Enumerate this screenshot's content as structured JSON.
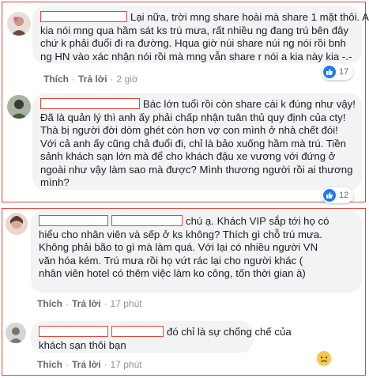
{
  "comments": [
    {
      "lines": [
        "Lại nữa, trời mng share hoài mà share 1 mặt thôi. A",
        "kia nói mng qua hầm sát ks trú mưa, rất nhiều ng đang trú bên đây",
        "chứ k phải đuổi đi ra đường. Hqua giờ núi share núi ng nói rồi bnh",
        "ng HN vào xác nhận nói rồi mà mng vẫn share r nói a kia này kia -.-"
      ],
      "actions": {
        "like": "Thích",
        "reply": "Trả lời",
        "time": "2 giờ"
      },
      "reactions": {
        "type": "like",
        "count": "17"
      }
    },
    {
      "lines": [
        "Bác lớn tuổi rồi còn share cái k đúng như vậy!",
        "Đã là quản lý thì anh ấy phải chấp nhận tuân thủ quy định của cty!",
        "Thà bị người đời dòm ghét còn hơn vợ con mình ở nhà chết đói!",
        "Với cả anh ấy cũng chả đuổi đi, chỉ là bảo xuống hầm mà trú. Tiền",
        "sảnh khách sạn lớn mà để cho khách đậu xe vương với đứng ở",
        "ngoài như vậy làm sao mà được? Mình thương người rồi ai thương",
        "mình?"
      ],
      "actions": {
        "like": "Thích",
        "reply": "Trả lời",
        "time": ""
      },
      "reactions": {
        "type": "like",
        "count": "12"
      }
    },
    {
      "lines": [
        "chú ạ. Khách VIP sắp tới họ có",
        "hiểu cho nhân viên và sếp ở ks không? Thích gì chỗ trú mưa.",
        "Không phải bão to gì mà làm quá. Với lại có nhiều người VN",
        "văn hóa kém. Trú mưa rồi họ vứt rác lại cho người khác (",
        "nhân viên hotel có thêm việc làm ko công, tốn thời gian à)"
      ],
      "actions": {
        "like": "Thích",
        "reply": "Trả lời",
        "time": "17 phút"
      }
    },
    {
      "lines": [
        "đó chỉ là sự chống chế của",
        "khách sạn thôi bạn"
      ],
      "actions": {
        "like": "Thích",
        "reply": "Trả lời",
        "time": "17 phút"
      },
      "reactions": {
        "type": "sad"
      }
    }
  ],
  "colors": {
    "redaction_border": "#e0473a",
    "like_blue": "#2078f4",
    "bubble_bg": "#f2f3f5"
  }
}
